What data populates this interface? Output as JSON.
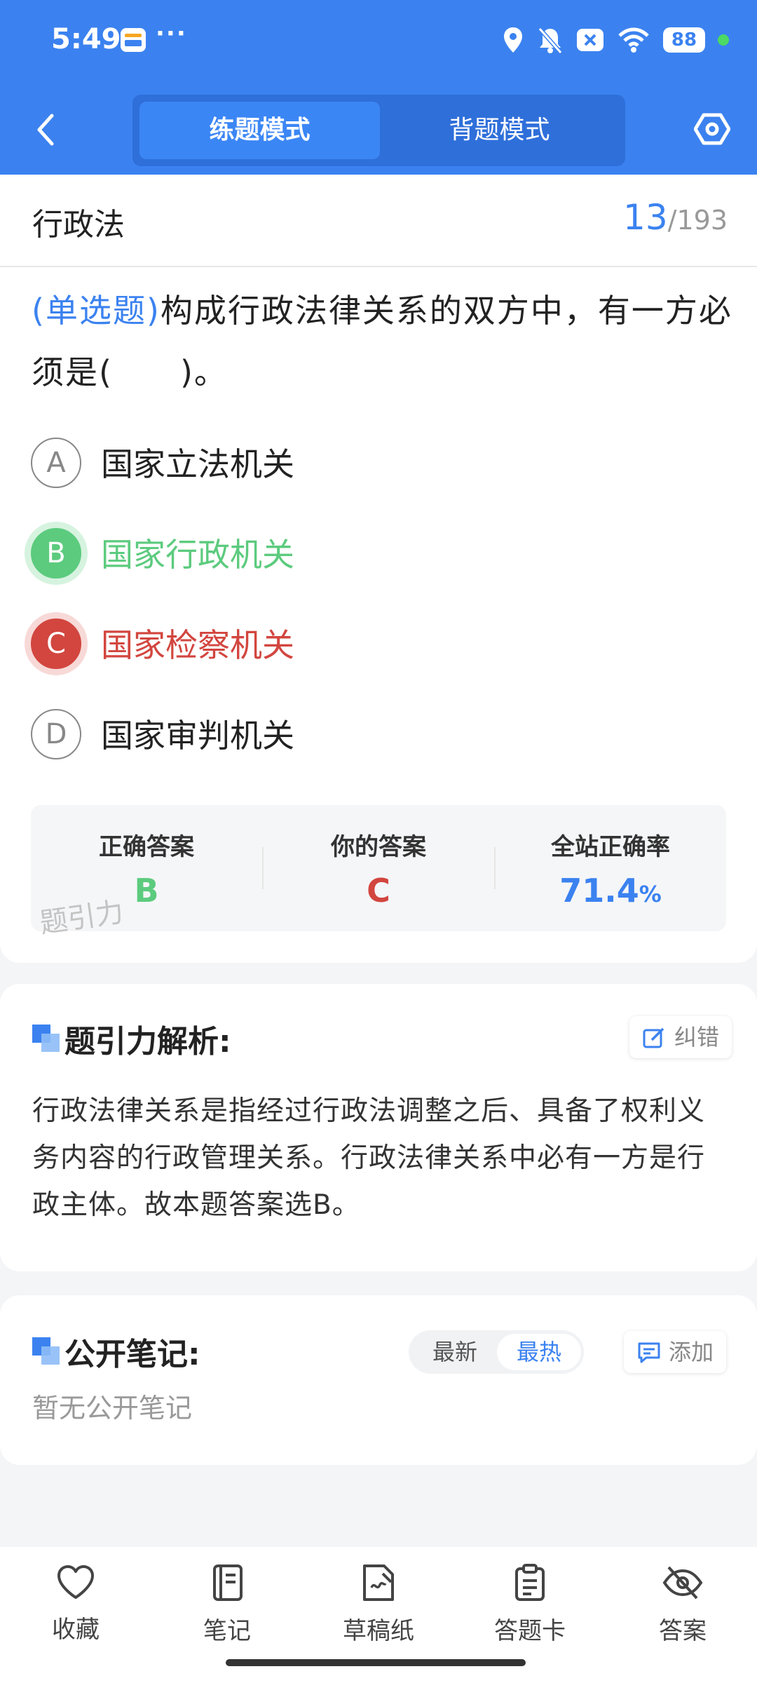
{
  "status_bar": {
    "time": "5:49",
    "more": "···",
    "battery": "88"
  },
  "header": {
    "tabs": [
      {
        "label": "练题模式",
        "active": true
      },
      {
        "label": "背题模式",
        "active": false
      }
    ]
  },
  "question": {
    "subject": "行政法",
    "current": "13",
    "total": "/193",
    "type": "(单选题)",
    "text": "构成行政法律关系的双方中，有一方必须是(　　)。",
    "options": [
      {
        "letter": "A",
        "text": "国家立法机关",
        "state": "normal"
      },
      {
        "letter": "B",
        "text": "国家行政机关",
        "state": "correct"
      },
      {
        "letter": "C",
        "text": "国家检察机关",
        "state": "wrong"
      },
      {
        "letter": "D",
        "text": "国家审判机关",
        "state": "normal"
      }
    ]
  },
  "answer_summary": {
    "correct_label": "正确答案",
    "correct_value": "B",
    "yours_label": "你的答案",
    "yours_value": "C",
    "rate_label": "全站正确率",
    "rate_value": "71.4",
    "rate_unit": "%",
    "watermark": "题引力"
  },
  "analysis": {
    "title": "题引力解析:",
    "report_label": "纠错",
    "text": "行政法律关系是指经过行政法调整之后、具备了权利义务内容的行政管理关系。行政法律关系中必有一方是行政主体。故本题答案选B。"
  },
  "notes": {
    "title": "公开笔记:",
    "sort_new": "最新",
    "sort_hot": "最热",
    "add_label": "添加",
    "empty_text": "暂无公开笔记"
  },
  "bottom_nav": [
    {
      "label": "收藏",
      "icon": "heart-icon"
    },
    {
      "label": "笔记",
      "icon": "notebook-icon"
    },
    {
      "label": "草稿纸",
      "icon": "draft-paper-icon"
    },
    {
      "label": "答题卡",
      "icon": "answer-sheet-icon"
    },
    {
      "label": "答案",
      "icon": "eye-off-icon"
    }
  ],
  "colors": {
    "brand": "#3b82f0",
    "correct": "#5ccb7e",
    "wrong": "#d2463f"
  }
}
